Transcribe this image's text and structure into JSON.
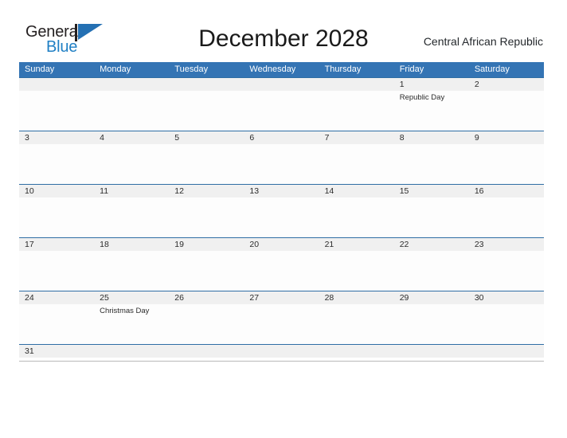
{
  "brand": {
    "word_one": "General",
    "word_two": "Blue",
    "flag_icon": "flag-triangle-icon",
    "accent_color": "#1f7fc4"
  },
  "header": {
    "title": "December 2028",
    "locale": "Central African Republic"
  },
  "theme": {
    "header_blue": "#3474b4",
    "row_rule_blue": "#2e6da4",
    "date_band_gray": "#f0f0f0",
    "text_dark": "#2b2b2b"
  },
  "calendar": {
    "month": "December",
    "year": "2028",
    "weekday_headers": [
      "Sunday",
      "Monday",
      "Tuesday",
      "Wednesday",
      "Thursday",
      "Friday",
      "Saturday"
    ],
    "weeks": [
      {
        "days": [
          {
            "date": "",
            "event": ""
          },
          {
            "date": "",
            "event": ""
          },
          {
            "date": "",
            "event": ""
          },
          {
            "date": "",
            "event": ""
          },
          {
            "date": "",
            "event": ""
          },
          {
            "date": "1",
            "event": "Republic Day"
          },
          {
            "date": "2",
            "event": ""
          }
        ]
      },
      {
        "days": [
          {
            "date": "3",
            "event": ""
          },
          {
            "date": "4",
            "event": ""
          },
          {
            "date": "5",
            "event": ""
          },
          {
            "date": "6",
            "event": ""
          },
          {
            "date": "7",
            "event": ""
          },
          {
            "date": "8",
            "event": ""
          },
          {
            "date": "9",
            "event": ""
          }
        ]
      },
      {
        "days": [
          {
            "date": "10",
            "event": ""
          },
          {
            "date": "11",
            "event": ""
          },
          {
            "date": "12",
            "event": ""
          },
          {
            "date": "13",
            "event": ""
          },
          {
            "date": "14",
            "event": ""
          },
          {
            "date": "15",
            "event": ""
          },
          {
            "date": "16",
            "event": ""
          }
        ]
      },
      {
        "days": [
          {
            "date": "17",
            "event": ""
          },
          {
            "date": "18",
            "event": ""
          },
          {
            "date": "19",
            "event": ""
          },
          {
            "date": "20",
            "event": ""
          },
          {
            "date": "21",
            "event": ""
          },
          {
            "date": "22",
            "event": ""
          },
          {
            "date": "23",
            "event": ""
          }
        ]
      },
      {
        "days": [
          {
            "date": "24",
            "event": ""
          },
          {
            "date": "25",
            "event": "Christmas Day"
          },
          {
            "date": "26",
            "event": ""
          },
          {
            "date": "27",
            "event": ""
          },
          {
            "date": "28",
            "event": ""
          },
          {
            "date": "29",
            "event": ""
          },
          {
            "date": "30",
            "event": ""
          }
        ]
      },
      {
        "short": true,
        "days": [
          {
            "date": "31",
            "event": ""
          },
          {
            "date": "",
            "event": ""
          },
          {
            "date": "",
            "event": ""
          },
          {
            "date": "",
            "event": ""
          },
          {
            "date": "",
            "event": ""
          },
          {
            "date": "",
            "event": ""
          },
          {
            "date": "",
            "event": ""
          }
        ]
      }
    ]
  }
}
